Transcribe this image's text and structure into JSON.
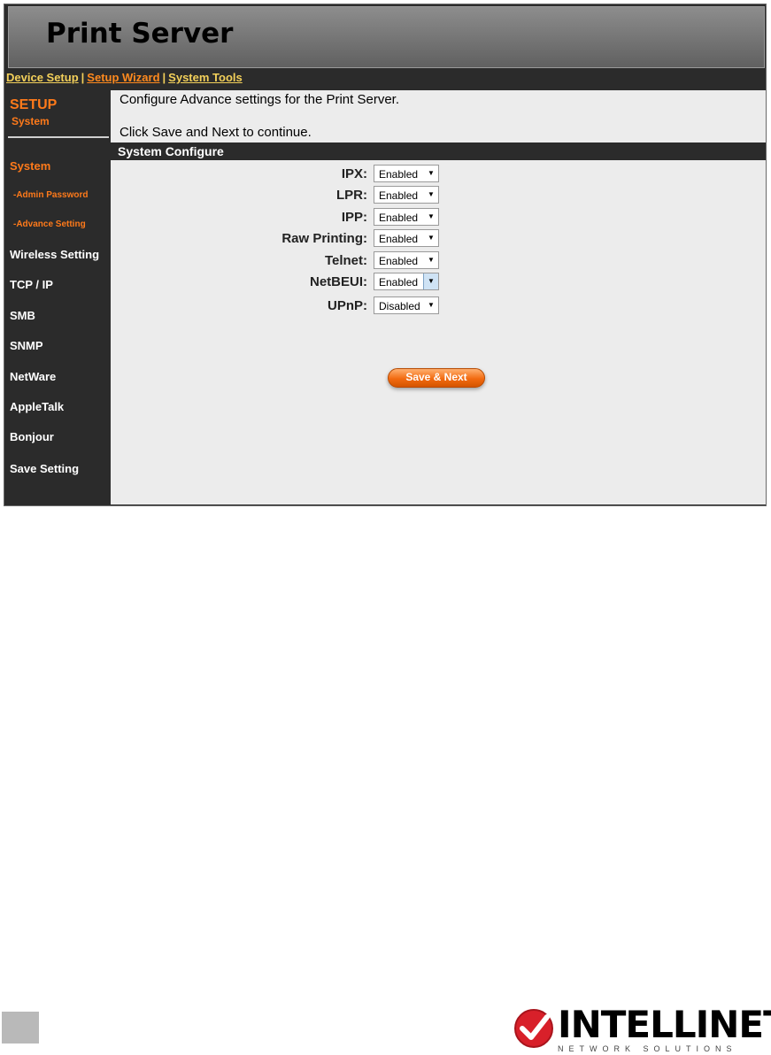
{
  "header": {
    "title": "Print Server"
  },
  "topnav": {
    "items": [
      {
        "label": "Device Setup"
      },
      {
        "label": "Setup Wizard"
      },
      {
        "label": "System Tools"
      }
    ],
    "separator": "|"
  },
  "sidebar": {
    "heading": "SETUP",
    "subheading": "System",
    "items": [
      {
        "label": "System"
      },
      {
        "label": "-Admin Password"
      },
      {
        "label": "-Advance Setting"
      },
      {
        "label": "Wireless Setting"
      },
      {
        "label": "TCP / IP"
      },
      {
        "label": "SMB"
      },
      {
        "label": "SNMP"
      },
      {
        "label": "NetWare"
      },
      {
        "label": "AppleTalk"
      },
      {
        "label": "Bonjour"
      },
      {
        "label": "Save Setting"
      }
    ]
  },
  "content": {
    "intro_line1": "Configure Advance settings for the Print Server.",
    "intro_line2": "Click Save and Next to continue.",
    "section_title": "System Configure",
    "fields": [
      {
        "label": "IPX:",
        "value": "Enabled"
      },
      {
        "label": "LPR:",
        "value": "Enabled"
      },
      {
        "label": "IPP:",
        "value": "Enabled"
      },
      {
        "label": "Raw Printing:",
        "value": "Enabled"
      },
      {
        "label": "Telnet:",
        "value": "Enabled"
      },
      {
        "label": "NetBEUI:",
        "value": "Enabled"
      },
      {
        "label": "UPnP:",
        "value": "Disabled"
      }
    ],
    "save_button": "Save & Next"
  },
  "footer": {
    "logo_text": "INTELLINET",
    "logo_subtext": "NETWORK SOLUTIONS"
  },
  "colors": {
    "accent": "#ff7a1a",
    "nav_link": "#f3d05a",
    "frame": "#2b2b2b",
    "content_bg": "#ececec"
  }
}
